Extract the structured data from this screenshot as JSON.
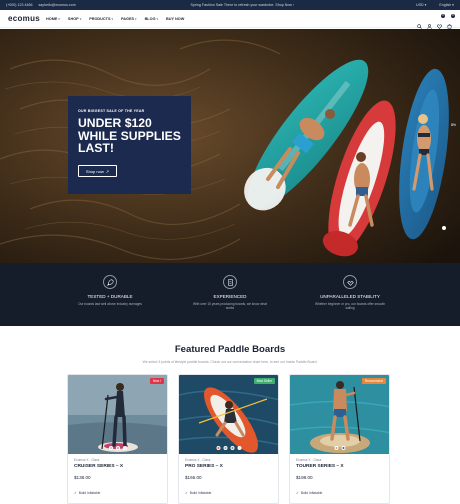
{
  "topbar": {
    "phone": "(+000) 123 4466",
    "email": "sayhello@ecomus.com",
    "announcement": "Spring Fashion Sale There to refresh your wardrobe. Shop Now ›",
    "currency": "USD",
    "language": "English"
  },
  "header": {
    "logo": "ecomus",
    "nav": [
      {
        "label": "HOME"
      },
      {
        "label": "SHOP"
      },
      {
        "label": "PRODUCTS"
      },
      {
        "label": "PAGES"
      },
      {
        "label": "BLOG"
      },
      {
        "label": "BUY NOW"
      }
    ],
    "wishlist_count": "0",
    "cart_count": "0"
  },
  "hero": {
    "kicker": "OUR BIGGEST SALE OF THE YEAR",
    "headline_1": "UNDER $120",
    "headline_2": "WHILE SUPPLIES",
    "headline_3": "LAST!",
    "button": "Shop now",
    "side_label": "8%"
  },
  "features": [
    {
      "title": "TESTED + DURABLE",
      "desc": "Our boards last well above industry averages"
    },
    {
      "title": "EXPERIENCED",
      "desc": "With over 15 years producing boards, we know what works"
    },
    {
      "title": "UNPARALLELED STABILITY",
      "desc": "Whether beginner or pro, our boards offer smooth sailing"
    }
  ],
  "section": {
    "title": "Featured Paddle Boards",
    "subtitle": "We select 3 points of lifestyle paddle boards. Check out our conversation chart here, to see our Inside Paddle Board."
  },
  "products": [
    {
      "tag": "New !",
      "category": "Ecomus X - Class",
      "name": "CRUISER SERIES – X",
      "price": "$138.00",
      "feature": "Build Inflatable"
    },
    {
      "tag": "Best Seller",
      "category": "Ecomus X - Class",
      "name": "PRO SERIES – X",
      "price": "$166.00",
      "feature": "Build Inflatable"
    },
    {
      "tag": "Recommend",
      "category": "Ecomus X - Class",
      "name": "TOURER SERIES – X",
      "price": "$198.00",
      "feature": "Build Inflatable"
    }
  ],
  "colors": {
    "navy": "#1b2a4e",
    "dark_band": "#151d2b",
    "tag_new": "#e0344a",
    "tag_best": "#3fb06f",
    "tag_recommend": "#e8873a"
  }
}
